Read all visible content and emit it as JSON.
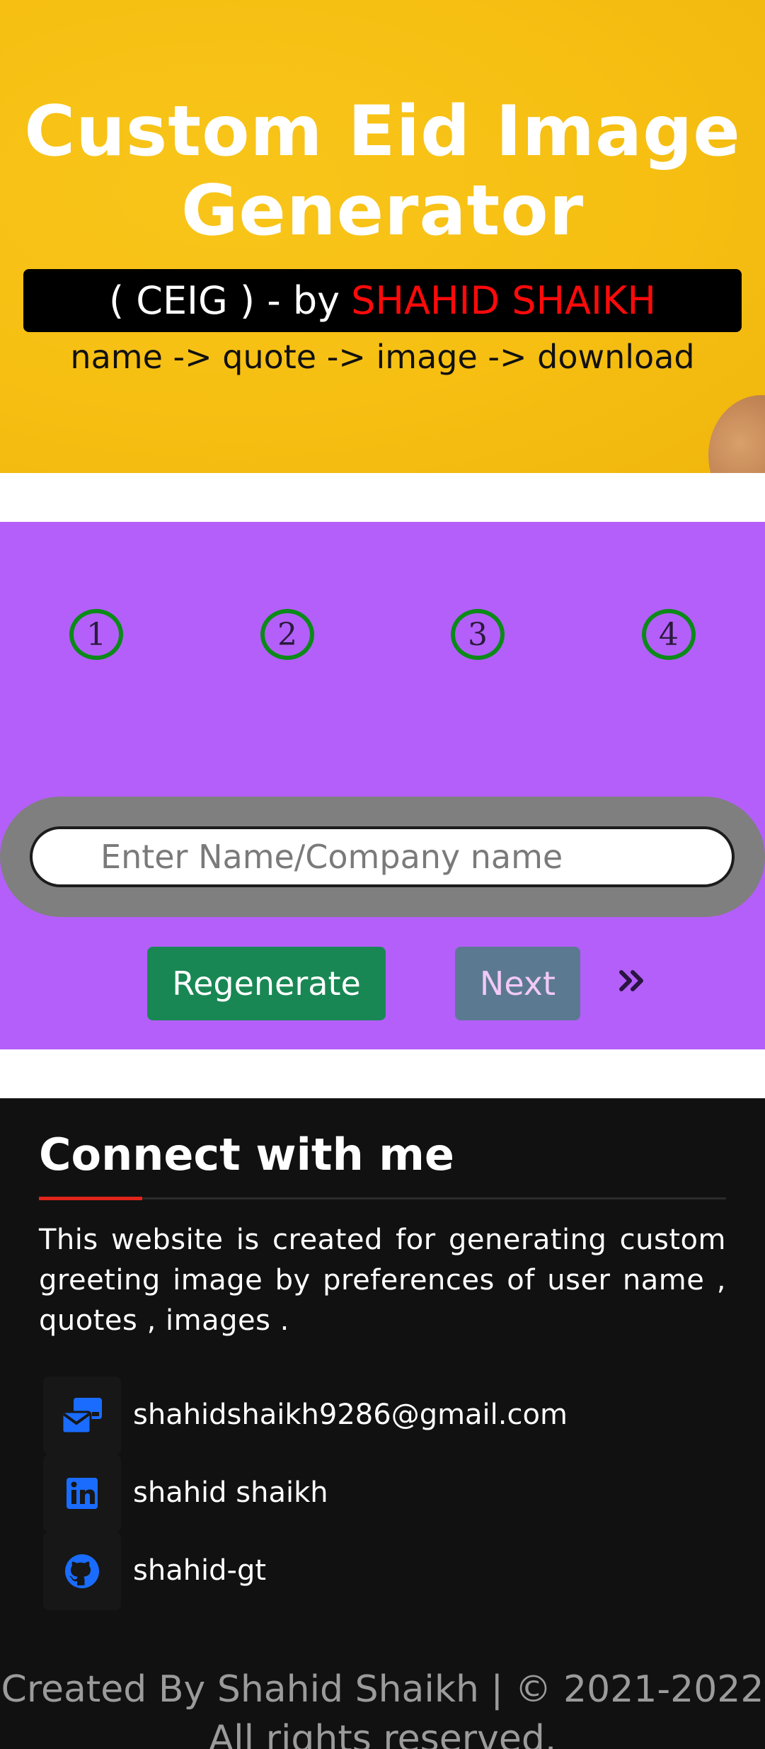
{
  "hero": {
    "title_line1": "Custom Eid Image",
    "title_line2": "Generator",
    "banner_prefix": "( CEIG ) - by",
    "banner_author": "SHAHID SHAIKH",
    "steps_text": "name -> quote -> image -> download"
  },
  "wizard": {
    "steps": [
      "1",
      "2",
      "3",
      "4"
    ],
    "name_placeholder": "Enter Name/Company name",
    "name_value": "",
    "regenerate_label": "Regenerate",
    "next_label": "Next"
  },
  "footer": {
    "connect_title": "Connect with me",
    "about": "This website is created for generating custom greeting image by preferences of user name , quotes , images .",
    "contacts": [
      {
        "icon": "mail-bulk-icon",
        "label": "shahidshaikh9286@gmail.com"
      },
      {
        "icon": "linkedin-icon",
        "label": "shahid shaikh"
      },
      {
        "icon": "github-icon",
        "label": "shahid-gt"
      }
    ],
    "copyright_line1": "Created By Shahid Shaikh | © 2021-2022",
    "copyright_line2": "All rights reserved."
  },
  "colors": {
    "hero_bg": "#f6bf12",
    "author_red": "#ff0a0a",
    "wizard_bg": "#b45ffa",
    "step_ring": "#0b8a18",
    "regenerate_bg": "#198754",
    "next_bg": "#5b7a91",
    "footer_bg": "#111111",
    "accent_red": "#e1251b",
    "icon_blue": "#1a6cff"
  }
}
